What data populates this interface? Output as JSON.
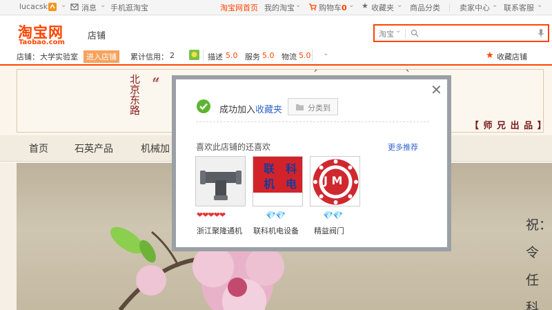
{
  "topbar": {
    "username": "lucacsk",
    "messages": "消息",
    "mobile": "手机逛淘宝",
    "home": "淘宝网首页",
    "my_taobao": "我的淘宝",
    "cart_label": "购物车",
    "cart_count": "0",
    "favorites": "收藏夹",
    "categories": "商品分类",
    "seller_center": "卖家中心",
    "contact": "联系客服"
  },
  "header": {
    "logo_main": "淘宝网",
    "logo_sub": "Taobao.com",
    "shop_label": "店铺",
    "search_category": "淘宝",
    "search_placeholder": ""
  },
  "shop": {
    "name_label": "店铺：",
    "name": "大学实验室",
    "enter": "进入店铺",
    "credit_label": "累计信用：",
    "credit": "2",
    "desc_label": "描述",
    "desc_score": "5.0",
    "service_label": "服务",
    "service_score": "5.0",
    "logistics_label": "物流",
    "logistics_score": "5.0",
    "favorite_shop": "收藏店铺"
  },
  "banner": {
    "vertical_text": "北京东路",
    "master": "【 师 兄 出 品 】"
  },
  "nav": {
    "items": [
      "首页",
      "石英产品",
      "机械加"
    ]
  },
  "photo": {
    "calligraphy": "祝：令任科"
  },
  "modal": {
    "success_text": "成功加入",
    "success_link": "收藏夹",
    "category_button": "分类到",
    "also_like": "喜欢此店铺的还喜欢",
    "more": "更多推荐",
    "shops": [
      {
        "name": "浙江聚隆通机",
        "rating": "hearts"
      },
      {
        "name": "联科机电设备",
        "rating": "diamonds",
        "thumb_text_1": "联　科",
        "thumb_text_2": "机　电"
      },
      {
        "name": "精益阀门",
        "rating": "diamonds",
        "thumb_letters": "J M"
      }
    ]
  },
  "colors": {
    "accent": "#ff4400",
    "link": "#3366cc",
    "banner_text": "#8a1f1f"
  }
}
